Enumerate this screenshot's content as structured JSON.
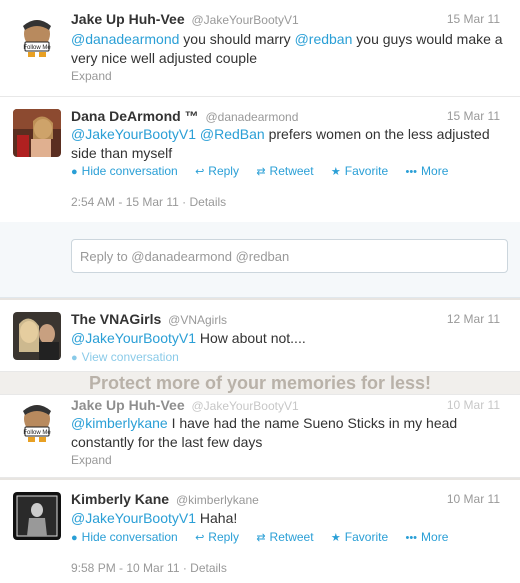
{
  "tweets": [
    {
      "name": "Jake Up Huh-Vee",
      "handle": "@JakeYourBootyV1",
      "date": "15 Mar 11",
      "text": [
        {
          "t": "@danadearmond",
          "m": true
        },
        {
          "t": " you should marry ",
          "m": false
        },
        {
          "t": "@redban",
          "m": true
        },
        {
          "t": " you guys would make a very nice well adjusted couple",
          "m": false
        }
      ],
      "expand": "Expand"
    },
    {
      "name": "Dana DeArmond ™",
      "handle": "@danadearmond",
      "date": "15 Mar 11",
      "text": [
        {
          "t": "@JakeYourBootyV1",
          "m": true
        },
        {
          "t": " ",
          "m": false
        },
        {
          "t": "@RedBan",
          "m": true
        },
        {
          "t": " prefers women on the less adjusted side than myself",
          "m": false
        }
      ],
      "actions": {
        "hide": "Hide conversation",
        "reply": "Reply",
        "retweet": "Retweet",
        "favorite": "Favorite",
        "more": "More"
      },
      "meta": "2:54 AM - 15 Mar 11 · Details"
    },
    {
      "name": "The VNAGirls",
      "handle": "@VNAgirls",
      "date": "12 Mar 11",
      "text": [
        {
          "t": "@JakeYourBootyV1",
          "m": true
        },
        {
          "t": " How about not....",
          "m": false
        }
      ],
      "view": "View conversation"
    },
    {
      "name": "Jake Up Huh-Vee",
      "handle": "@JakeYourBootyV1",
      "date": "10 Mar 11",
      "text": [
        {
          "t": "@kimberlykane",
          "m": true
        },
        {
          "t": " I have had the name Sueno Sticks in my head constantly for the last few days",
          "m": false
        }
      ],
      "expand": "Expand"
    },
    {
      "name": "Kimberly Kane",
      "handle": "@kimberlykane",
      "date": "10 Mar 11",
      "text": [
        {
          "t": "@JakeYourBootyV1",
          "m": true
        },
        {
          "t": " Haha!",
          "m": false
        }
      ],
      "actions": {
        "hide": "Hide conversation",
        "reply": "Reply",
        "retweet": "Retweet",
        "favorite": "Favorite",
        "more": "More"
      },
      "meta": "9:58 PM - 10 Mar 11 · Details"
    }
  ],
  "reply_placeholder": "Reply to @danadearmond @redban",
  "watermark": "Protect more of your memories for less!",
  "colors": {
    "link": "#2a9fd6",
    "muted": "#999999"
  }
}
